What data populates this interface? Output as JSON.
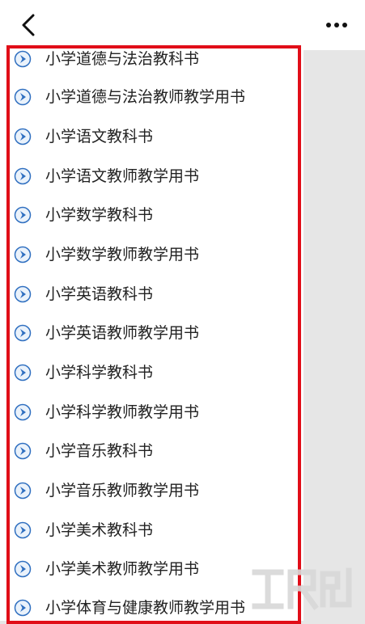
{
  "topbar": {
    "back_icon": "chevron-left-icon",
    "more_icon": "more-horizontal-icon"
  },
  "list": {
    "items": [
      {
        "label": "小学道德与法治教科书"
      },
      {
        "label": "小学道德与法治教师教学用书"
      },
      {
        "label": "小学语文教科书"
      },
      {
        "label": "小学语文教师教学用书"
      },
      {
        "label": "小学数学教科书"
      },
      {
        "label": "小学数学教师教学用书"
      },
      {
        "label": "小学英语教科书"
      },
      {
        "label": "小学英语教师教学用书"
      },
      {
        "label": "小学科学教科书"
      },
      {
        "label": "小学科学教师教学用书"
      },
      {
        "label": "小学音乐教科书"
      },
      {
        "label": "小学音乐教师教学用书"
      },
      {
        "label": "小学美术教科书"
      },
      {
        "label": "小学美术教师教学用书"
      },
      {
        "label": "小学体育与健康教师教学用书"
      }
    ],
    "item_icon": "play-circle-icon"
  },
  "colors": {
    "highlight": "#e10d18",
    "icon_blue": "#2f6fc0"
  }
}
